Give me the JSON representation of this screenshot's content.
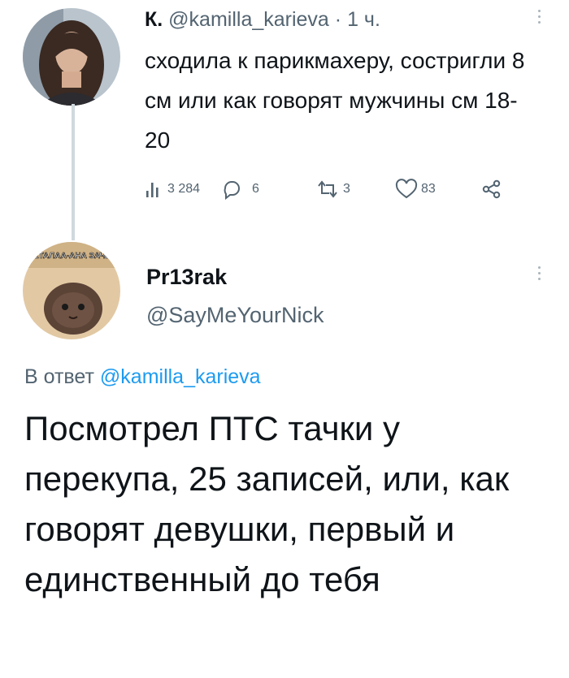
{
  "tweet1": {
    "author_name": "К.",
    "author_handle": "@kamilla_karieva",
    "separator": "·",
    "time": "1 ч.",
    "text": "сходила к парикмахеру, состригли 8 см или как говорят мужчины см 18-20",
    "stats": {
      "views": "3 284",
      "replies": "6",
      "retweets": "3",
      "likes": "83"
    },
    "icons": [
      "views-icon",
      "reply-icon",
      "retweet-icon",
      "like-icon",
      "share-icon",
      "more-icon"
    ]
  },
  "tweet2": {
    "author_name": "Pr13rak",
    "author_handle": "@SayMeYourNick",
    "avatar_caption": "ЧЕТАЛАА-АНА ЗАЧЕТ",
    "reply_prefix": "В ответ",
    "reply_to_handle": "@kamilla_karieva",
    "text": "Посмотрел ПТС тачки у перекупа, 25 записей, или, как говорят девушки, первый и единственный до тебя"
  },
  "colors": {
    "text": "#0f1419",
    "secondary": "#536471",
    "link": "#1d9bf0",
    "thread_line": "#cfd9de"
  }
}
